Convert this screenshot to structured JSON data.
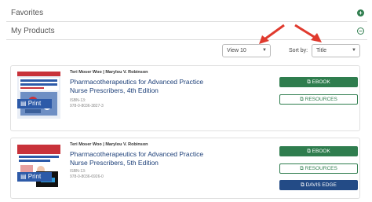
{
  "sections": {
    "favorites": {
      "label": "Favorites",
      "toggle": "+"
    },
    "my_products": {
      "label": "My Products",
      "toggle": "−"
    }
  },
  "controls": {
    "view_value": "View 10",
    "sort_label": "Sort by:",
    "sort_value": "Title"
  },
  "products": [
    {
      "authors": "Teri Moser Woo | Marylou V. Robinson",
      "title": "Pharmacotherapeutics for Advanced Practice Nurse Prescribers, 4th Edition",
      "isbn_label": "ISBN-13:",
      "isbn": "978-0-8036-3827-3",
      "format_tag": "Print",
      "buttons": [
        "EBOOK",
        "RESOURCES"
      ]
    },
    {
      "authors": "Teri Moser Woo | Marylou V. Robinson",
      "title": "Pharmacotherapeutics for Advanced Practice Nurse Prescribers, 5th Edition",
      "isbn_label": "ISBN-13:",
      "isbn": "978-0-8036-6926-0",
      "format_tag": "Print",
      "buttons": [
        "EBOOK",
        "RESOURCES",
        "DAVIS EDGE"
      ]
    }
  ],
  "colors": {
    "green": "#2f7d4e",
    "blue": "#234b86",
    "arrow": "#e03a2e"
  }
}
